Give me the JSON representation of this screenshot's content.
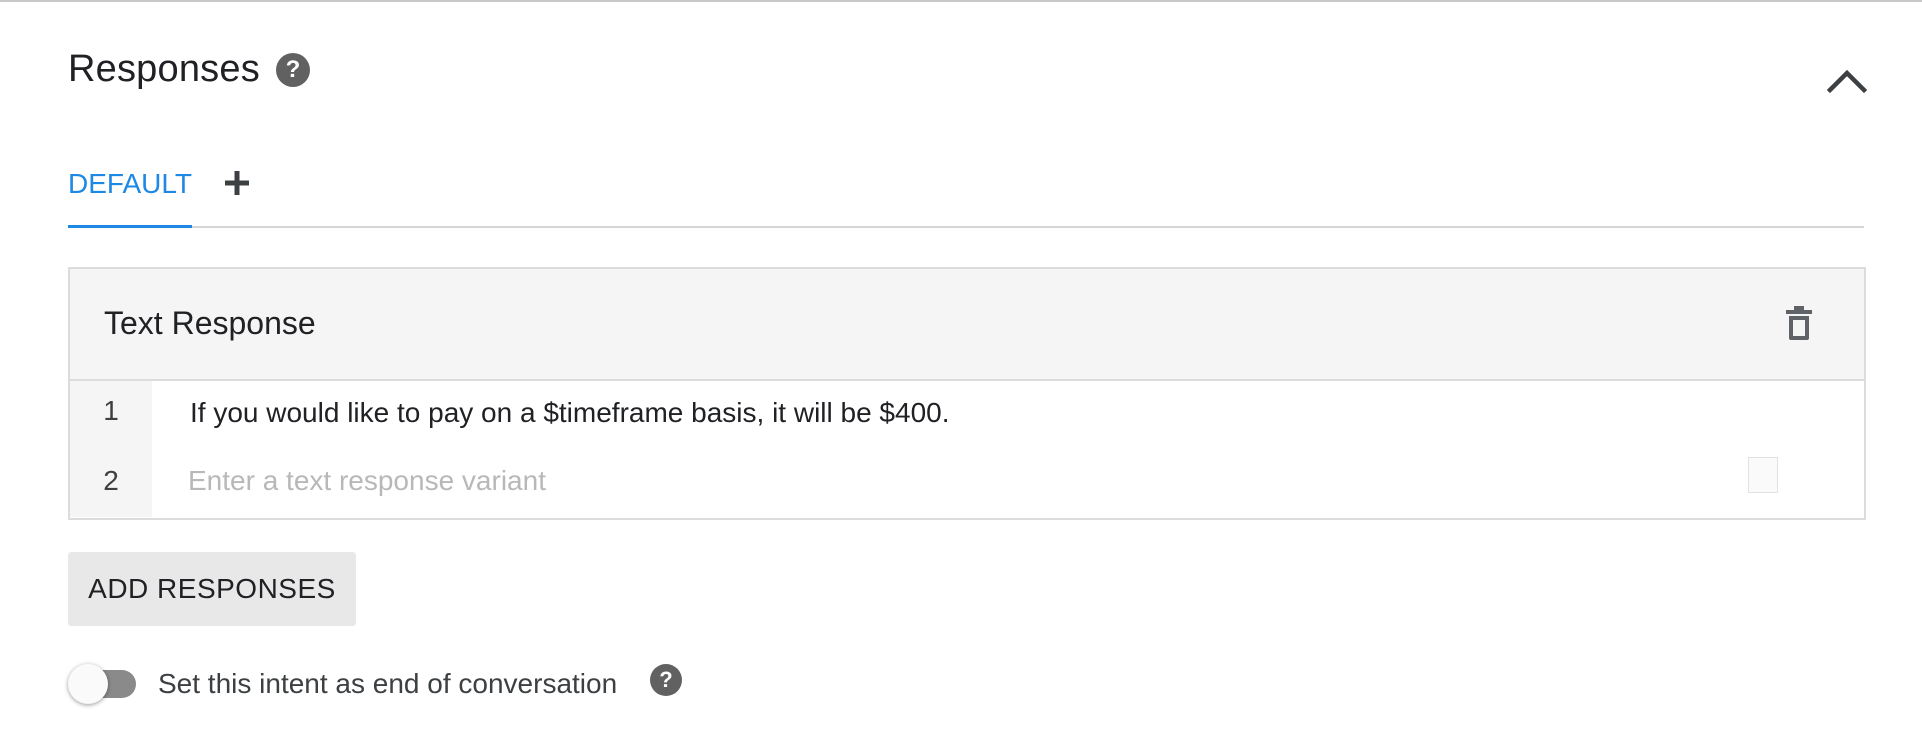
{
  "section": {
    "title": "Responses",
    "help_icon": "?"
  },
  "tabs": {
    "default_label": "DEFAULT",
    "add_icon": "plus-icon"
  },
  "text_response": {
    "title": "Text Response",
    "rows": [
      {
        "num": "1",
        "text": "If you would like to pay on a $timeframe basis, it will be $400."
      },
      {
        "num": "2",
        "value": "",
        "placeholder": "Enter a text response variant"
      }
    ]
  },
  "actions": {
    "add_responses_label": "ADD RESPONSES"
  },
  "end_conversation": {
    "label": "Set this intent as end of conversation",
    "enabled": false,
    "help_icon": "?"
  },
  "colors": {
    "accent": "#1e88e5",
    "icon_gray": "#616161",
    "header_bg": "#f5f5f5",
    "button_bg": "#e8e8e8"
  }
}
